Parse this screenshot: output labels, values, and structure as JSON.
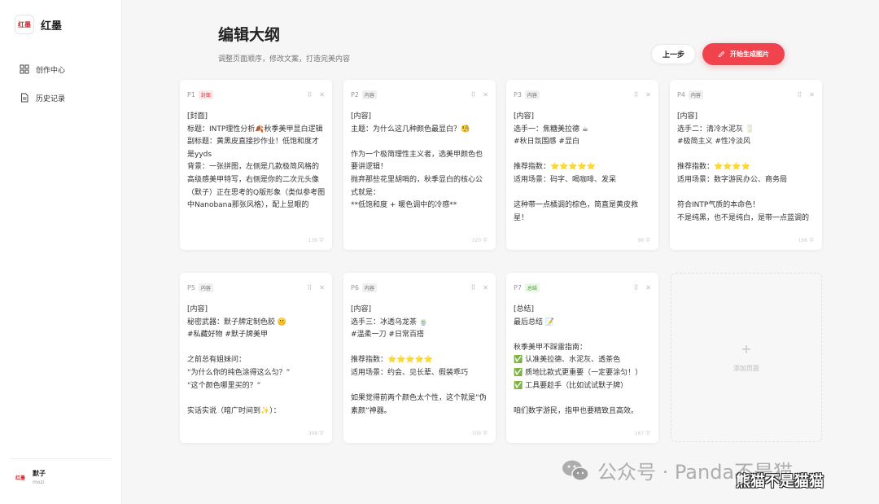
{
  "brand": {
    "logo_text": "红墨",
    "name": "红墨"
  },
  "nav": [
    {
      "label": "创作中心",
      "icon": "grid-icon"
    },
    {
      "label": "历史记录",
      "icon": "document-icon"
    }
  ],
  "user": {
    "avatar_text": "红墨",
    "name": "默子",
    "id": "mozi"
  },
  "header": {
    "title": "编辑大纲",
    "subtitle": "调整页面顺序，修改文案，打造完美内容",
    "prev_label": "上一步",
    "generate_label": "开始生成图片"
  },
  "cards": [
    {
      "num": "P1",
      "badge": "封面",
      "badge_type": "cover",
      "text": "[封面]\n标题：INTP理性分析🍂秋季美甲显白逻辑\n副标题：黄黑皮直接抄作业！低饱和度才是yyds\n背景：一张拼图，左侧是几款极简风格的高级感美甲特写，右侧是你的二次元头像（默子）正在思考的Q版形象（类似参考图中Nanobana那张风格），配上显眼的",
      "count": "136 字"
    },
    {
      "num": "P2",
      "badge": "内容",
      "badge_type": "content",
      "text": "[内容]\n主题：为什么这几种颜色最显白？🧐\n\n作为一个极简理性主义者，选美甲颜色也要讲逻辑！\n抛弃那些花里胡哨的，秋季显白的核心公式就是：\n**低饱和度 + 暖色调中的冷感**\n\n...",
      "count": "320 字"
    },
    {
      "num": "P3",
      "badge": "内容",
      "badge_type": "content",
      "text": "[内容]\n选手一：焦糖美拉德 ☕\n#秋日氛围感 #显白\n\n推荐指数：⭐⭐⭐⭐⭐\n适用场景：码字、喝咖啡、发呆\n\n这种带一点橘调的棕色，简直是黄皮救星！",
      "count": "98 字"
    },
    {
      "num": "P4",
      "badge": "内容",
      "badge_type": "content",
      "text": "[内容]\n选手二：清冷水泥灰 🥛\n#极简主义 #性冷淡风\n\n推荐指数：⭐⭐⭐⭐\n适用场景：数字游民办公、商务局\n\n符合INTP气质的本命色！\n不是纯黑，也不是纯白，是带一点蓝调的",
      "count": "166 字"
    },
    {
      "num": "P5",
      "badge": "内容",
      "badge_type": "content",
      "text": "[内容]\n秘密武器：默子牌定制色胶 🤫\n#私藏好物 #默子牌美甲\n\n之前总有姐妹问：\n“为什么你的纯色涂得这么匀？”\n“这个颜色哪里买的？”\n\n实话实说（暗广时间到✨）：",
      "count": "308 字"
    },
    {
      "num": "P6",
      "badge": "内容",
      "badge_type": "content",
      "text": "[内容]\n选手三：冰透乌龙茶 🍵\n#温柔一刀 #日常百搭\n\n推荐指数：⭐⭐⭐⭐⭐\n适用场景：约会、见长辈、假装乖巧\n\n如果觉得前两个颜色太个性，这个就是“伪素颜”神器。",
      "count": "309 字"
    },
    {
      "num": "P7",
      "badge": "总结",
      "badge_type": "summary",
      "text": "[总结]\n最后总结 📝\n\n秋季美甲不踩雷指南：\n✅ 认准美拉德、水泥灰、透茶色\n✅ 质地比款式更重要（一定要涂匀！）\n✅ 工具要趁手（比如试试默子牌）\n\n咱们数字游民，指甲也要精致且高效。",
      "count": "167 字"
    }
  ],
  "add_card": {
    "plus": "+",
    "label": "添加页面"
  },
  "watermark": {
    "main": "公众号 · Panda不是猫",
    "sub": "熊猫不是猫猫"
  },
  "colors": {
    "accent": "#f0434d",
    "cover_badge": "#e0333d",
    "summary_badge": "#3e9b2b"
  }
}
